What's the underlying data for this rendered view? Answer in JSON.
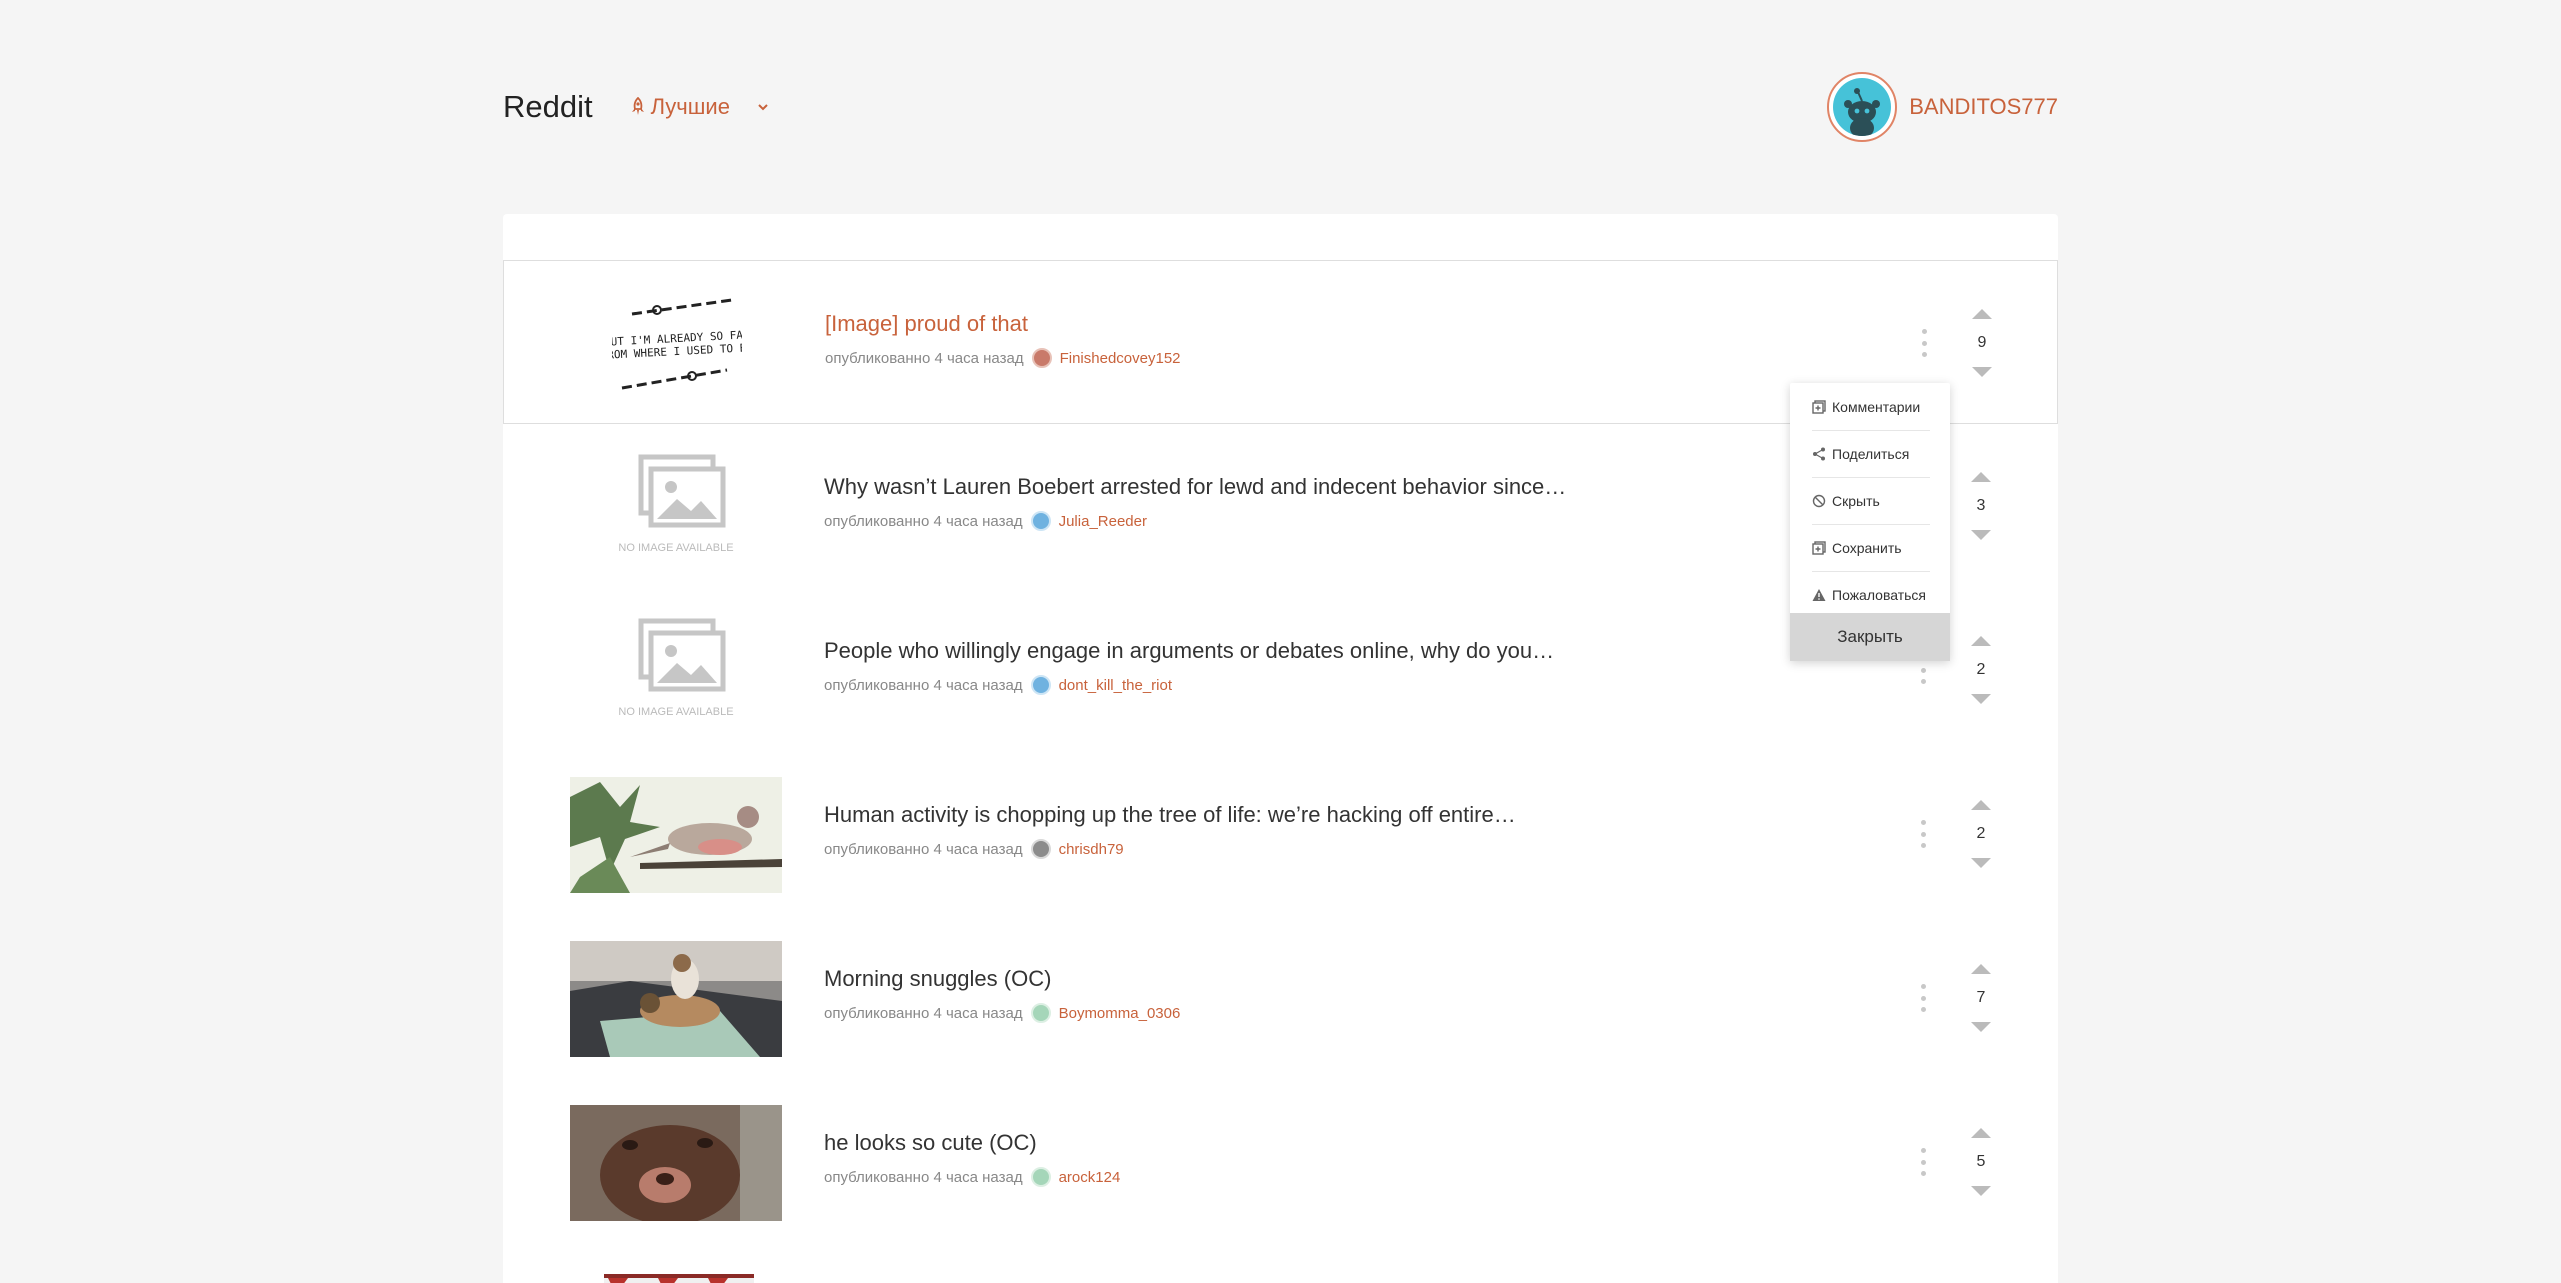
{
  "header": {
    "brand": "Reddit",
    "sort_label": "Лучшие",
    "username": "BANDITOS777"
  },
  "meta_prefix": "опубликованно 4 часа назад",
  "posts": [
    {
      "title": "[Image] proud of that",
      "author": "Finishedcovey152",
      "score": "9",
      "thumb": "handwritten-text-image"
    },
    {
      "title": "Why wasn’t Lauren Boebert arrested for lewd and indecent behavior since…",
      "author": "Julia_Reeder",
      "score": "3",
      "thumb": "no-image"
    },
    {
      "title": "People who willingly engage in arguments or debates online, why do you…",
      "author": "dont_kill_the_riot",
      "score": "2",
      "thumb": "no-image"
    },
    {
      "title": "Human activity is chopping up the tree of life: we’re hacking off entire…",
      "author": "chrisdh79",
      "score": "2",
      "thumb": "bird-illustration"
    },
    {
      "title": "Morning snuggles (OC)",
      "author": "Boymomma_0306",
      "score": "7",
      "thumb": "cat-and-dog-photo"
    },
    {
      "title": "he looks so cute (OC)",
      "author": "arock124",
      "score": "5",
      "thumb": "brown-dog-photo"
    }
  ],
  "thumb_text": {
    "handwritten": "BUT I'M ALREADY SO FAR FROM WHERE I USED TO BE",
    "no_image": "NO IMAGE AVAILABLE"
  },
  "menu": {
    "items": [
      "Комментарии",
      "Поделиться",
      "Скрыть",
      "Сохранить",
      "Пожаловаться"
    ],
    "close": "Закрыть"
  },
  "colors": {
    "accent": "#c8623b",
    "background": "#f5f5f5",
    "avatar": "#46c2d8"
  }
}
